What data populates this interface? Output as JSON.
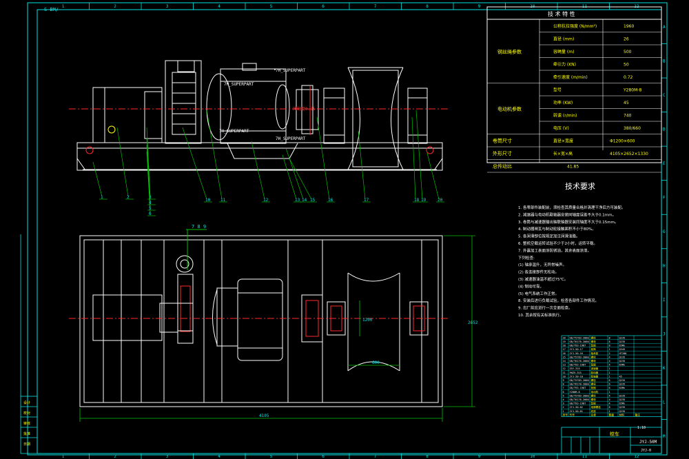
{
  "sheet": {
    "code_top_left": "S-BM/",
    "columns": [
      "1",
      "2",
      "3",
      "4",
      "5",
      "6",
      "7",
      "8",
      "9",
      "10",
      "11",
      "12"
    ],
    "rows": [
      "A",
      "B",
      "C",
      "D",
      "E",
      "F",
      "G",
      "H",
      "I",
      "J",
      "K",
      "L",
      "M"
    ]
  },
  "spec_table": {
    "title": "技 术 特 性",
    "groups": [
      {
        "label": "钢丝绳参数",
        "rows": [
          {
            "name": "公称抗拉强度 (N/mm²)",
            "value": "1960"
          },
          {
            "name": "直径 (mm)",
            "value": "26"
          },
          {
            "name": "容绳量 (m)",
            "value": "500"
          },
          {
            "name": "牵引力 (KN)",
            "value": "50"
          },
          {
            "name": "牵引速度 (m/min)",
            "value": "0.72"
          }
        ]
      },
      {
        "label": "电动机参数",
        "rows": [
          {
            "name": "型号",
            "value": "Y280M-8"
          },
          {
            "name": "功率 (KW)",
            "value": "45"
          },
          {
            "name": "转速 (r/min)",
            "value": "740"
          },
          {
            "name": "电压 (V)",
            "value": "380/660"
          }
        ]
      }
    ],
    "extra_rows": [
      {
        "label": "卷筒尺寸",
        "name": "直径×宽度",
        "value": "Φ1200×600"
      },
      {
        "label": "外形尺寸",
        "name": "长×宽×高",
        "value": "4105×2652×1330"
      },
      {
        "label": "总传动比",
        "name": "",
        "value": "41.85"
      }
    ]
  },
  "tech_requirements": {
    "title": "技术要求",
    "items": [
      "1. 各零部件装配前，须检查其质量合格并清理干净后方可装配。",
      "2. 减速器与电动机联轴器安装同轴度误差不大于0.1mm。",
      "3. 卷筒与减速器输出轴联轴器安装同轴度不大于0.15mm。",
      "4. 制动器闸瓦与制动轮接触面积不小于80%。",
      "5. 各润滑部位按规定加注润滑油脂。",
      "6. 整机空载运转试验不少于2小时，运转平稳。",
      "7. 外露加工表面涂防锈油，其余表面涂漆。"
    ],
    "sub_title": "下列检查:",
    "sub_items": [
      "(1) 轴承温升，无异常噪声。",
      "(2) 各连接部件无松动。",
      "(3) 减速器油温不超过75℃。",
      "(4) 制动可靠。",
      "(5) 电气系统工作正常。"
    ],
    "tail": [
      "8. 安装后进行负载试验，检查各部件工作情况。",
      "9. 出厂前应进行一次全面检查。",
      "10. 其余按有关标准执行。"
    ]
  },
  "side_view": {
    "superpart_labels": [
      "7H_SUPERPART",
      "7H_SUPERPART",
      "7H_SUPERPART",
      "7H_SUPERPART"
    ],
    "balloons": [
      "1",
      "2",
      "3",
      "4",
      "5",
      "6",
      "7",
      "8",
      "9",
      "10",
      "11",
      "12",
      "13",
      "14",
      "15",
      "16",
      "17",
      "18",
      "19",
      "20"
    ],
    "red_note": "同轴度0.15"
  },
  "top_view": {
    "balloon_group": "7 8 9",
    "dim_length": "4105",
    "dim_width": "2652",
    "dim_drum_len": "600",
    "dim_small": "1200"
  },
  "bom": {
    "rows": [
      [
        "20",
        "GB/T5783-2000",
        "螺栓",
        "8",
        "Q235",
        ""
      ],
      [
        "19",
        "GB/T6170-2000",
        "螺母",
        "8",
        "Q235",
        ""
      ],
      [
        "18",
        "GB/T93-1987",
        "垫圈",
        "8",
        "65Mn",
        ""
      ],
      [
        "17",
        "JYJ-50-17",
        "卷筒",
        "1",
        "Q345",
        ""
      ],
      [
        "16",
        "JYJ-50-16",
        "轴承座",
        "2",
        "HT200",
        ""
      ],
      [
        "15",
        "GB/T5783-2000",
        "螺栓",
        "4",
        "Q235",
        ""
      ],
      [
        "14",
        "GB/T6170-2000",
        "螺母",
        "4",
        "Q235",
        ""
      ],
      [
        "13",
        "GB/T93-1987",
        "垫圈",
        "4",
        "65Mn",
        ""
      ],
      [
        "12",
        "ZSY-315",
        "减速器",
        "1",
        "",
        ""
      ],
      [
        "11",
        "YWZ5-315",
        "制动器",
        "1",
        "",
        ""
      ],
      [
        "10",
        "JYJ-50-10",
        "联轴器",
        "1",
        "45",
        ""
      ],
      [
        "9",
        "GB/T5783-2000",
        "螺栓",
        "6",
        "Q235",
        ""
      ],
      [
        "8",
        "GB/T6170-2000",
        "螺母",
        "6",
        "Q235",
        ""
      ],
      [
        "7",
        "GB/T93-1987",
        "垫圈",
        "6",
        "65Mn",
        ""
      ],
      [
        "6",
        "Y280M-8",
        "电动机",
        "1",
        "",
        ""
      ],
      [
        "5",
        "GB/T5783-2000",
        "螺栓",
        "4",
        "Q235",
        ""
      ],
      [
        "4",
        "GB/T6170-2000",
        "螺母",
        "4",
        "Q235",
        ""
      ],
      [
        "3",
        "GB/T93-1987",
        "垫圈",
        "4",
        "65Mn",
        ""
      ],
      [
        "2",
        "JYJ-50-02",
        "地脚螺栓",
        "8",
        "Q235",
        ""
      ],
      [
        "1",
        "JYJ-50-01",
        "底座",
        "1",
        "Q235",
        ""
      ]
    ],
    "header": [
      "序号",
      "代号",
      "名称",
      "数量",
      "材料",
      "备注"
    ]
  },
  "title_block": {
    "drawing_name": "绞车",
    "drawing_no": "JYJ-50M",
    "sheet": "JYJ-0",
    "scale": "1:10"
  },
  "left_strip": [
    "设计",
    "校对",
    "审核",
    "批准",
    "日期"
  ],
  "colors": {
    "background": "#000000",
    "border": "#00e5e5",
    "line_white": "#ffffff",
    "centerline": "#ff2a2a",
    "label_yellow": "#ffff00",
    "leader_green": "#00c000"
  }
}
